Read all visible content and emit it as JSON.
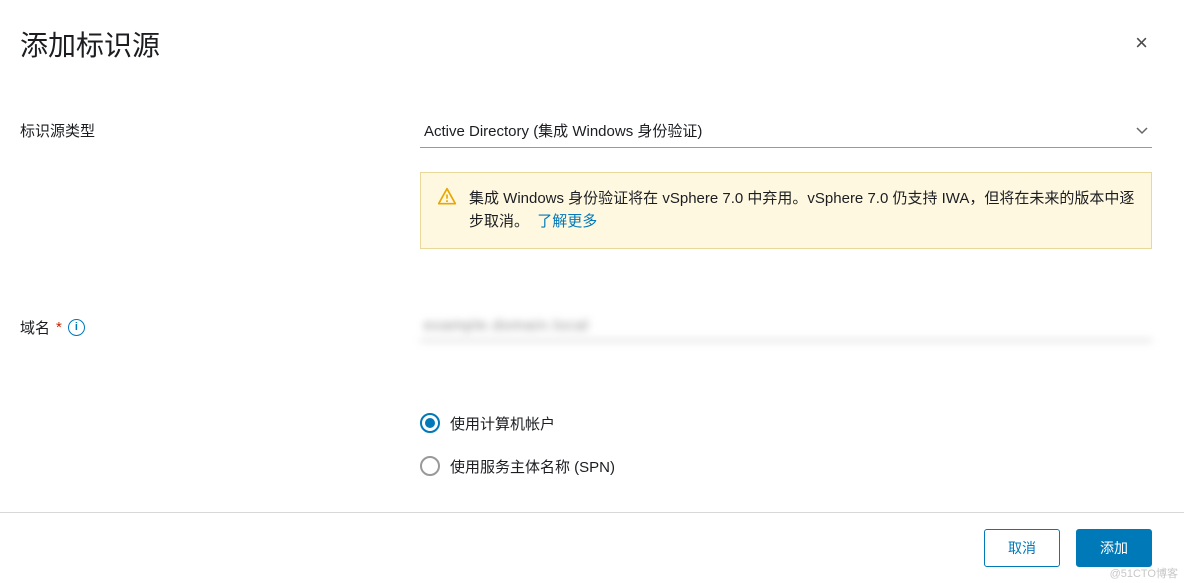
{
  "dialog": {
    "title": "添加标识源",
    "close_glyph": "×"
  },
  "form": {
    "source_type_label": "标识源类型",
    "source_type_value": "Active Directory (集成 Windows 身份验证)",
    "warning_text": "集成 Windows 身份验证将在 vSphere 7.0 中弃用。vSphere 7.0 仍支持 IWA，但将在未来的版本中逐步取消。",
    "warning_link": "了解更多",
    "domain_label": "域名",
    "domain_value": "example.domain.local",
    "info_glyph": "i",
    "radio": {
      "option1": "使用计算机帐户",
      "option2": "使用服务主体名称 (SPN)"
    }
  },
  "footer": {
    "cancel": "取消",
    "submit": "添加"
  },
  "watermark": "@51CTO博客"
}
